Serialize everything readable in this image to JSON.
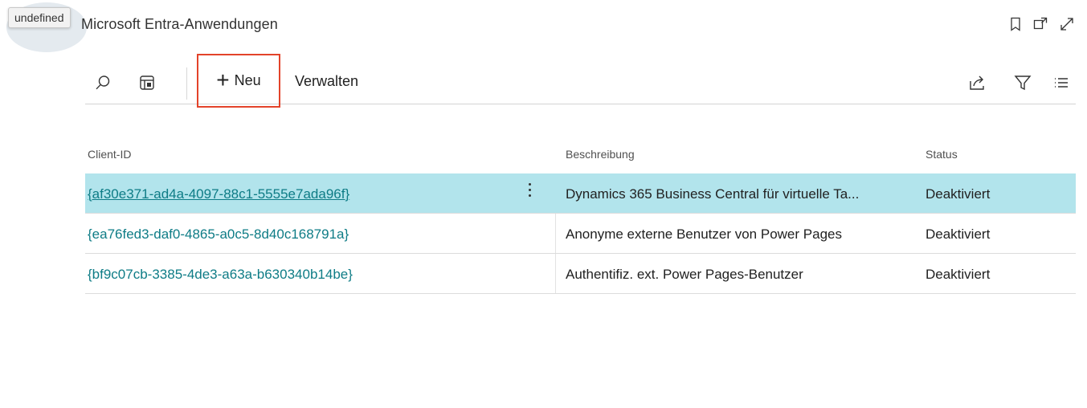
{
  "window": {
    "tooltip": "undefined",
    "title": "Microsoft Entra-Anwendungen"
  },
  "header_icons": [
    "bookmark-icon",
    "open-in-new-window-icon",
    "expand-icon"
  ],
  "toolbar": {
    "search_icon": "search-icon",
    "layout_icon": "table-layout-icon",
    "new_label": "Neu",
    "new_icon": "plus",
    "manage_label": "Verwalten",
    "share_icon": "share-icon",
    "filter_icon": "filter-icon",
    "list_icon": "list-view-icon"
  },
  "table": {
    "columns": [
      "Client-ID",
      "Beschreibung",
      "Status"
    ],
    "rows": [
      {
        "client_id": "{af30e371-ad4a-4097-88c1-5555e7ada96f}",
        "description": "Dynamics 365 Business Central für virtuelle Ta...",
        "status": "Deaktiviert",
        "selected": true
      },
      {
        "client_id": "{ea76fed3-daf0-4865-a0c5-8d40c168791a}",
        "description": "Anonyme externe Benutzer von Power Pages",
        "status": "Deaktiviert",
        "selected": false
      },
      {
        "client_id": "{bf9c07cb-3385-4de3-a63a-b630340b14be}",
        "description": "Authentifiz. ext. Power Pages-Benutzer",
        "status": "Deaktiviert",
        "selected": false
      }
    ]
  },
  "colors": {
    "accent": "#0e7c86",
    "selected_row": "#b2e4ec",
    "highlight_border": "#e3432a"
  }
}
